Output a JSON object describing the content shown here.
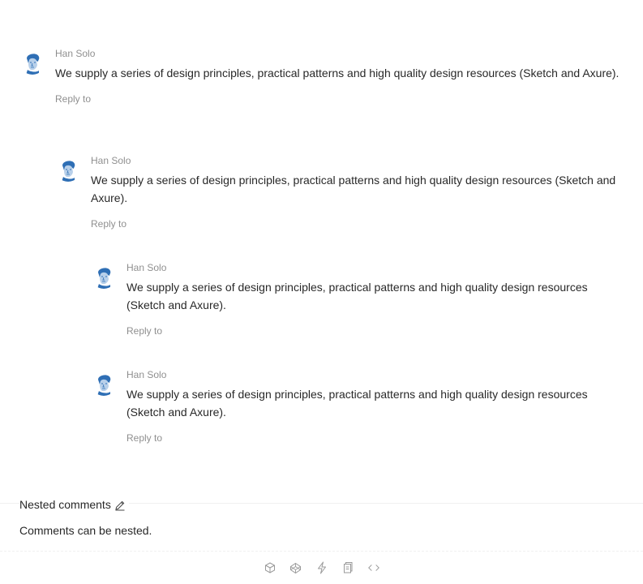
{
  "comments": [
    {
      "author": "Han Solo",
      "content": "We supply a series of design principles, practical patterns and high quality design resources (Sketch and Axure).",
      "reply_label": "Reply to"
    },
    {
      "author": "Han Solo",
      "content": "We supply a series of design principles, practical patterns and high quality design resources (Sketch and Axure).",
      "reply_label": "Reply to"
    },
    {
      "author": "Han Solo",
      "content": "We supply a series of design principles, practical patterns and high quality design resources (Sketch and Axure).",
      "reply_label": "Reply to"
    },
    {
      "author": "Han Solo",
      "content": "We supply a series of design principles, practical patterns and high quality design resources (Sketch and Axure).",
      "reply_label": "Reply to"
    }
  ],
  "meta": {
    "title": "Nested comments",
    "description": "Comments can be nested."
  },
  "toolbar": {
    "icons": [
      "codesandbox-icon",
      "codepen-icon",
      "stackblitz-icon",
      "copy-icon",
      "code-expand-icon"
    ]
  },
  "colors": {
    "text": "#262626",
    "secondary": "#8c8c8c",
    "divider": "#f0f0f0",
    "avatar": "#2f6fb5"
  }
}
